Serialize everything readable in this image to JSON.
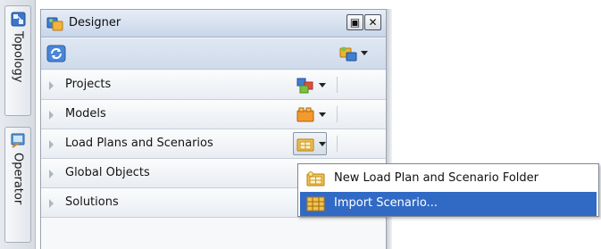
{
  "side_tabs": [
    {
      "label": "Topology",
      "icon": "topology-icon"
    },
    {
      "label": "Operator",
      "icon": "operator-icon"
    }
  ],
  "designer": {
    "title": "Designer",
    "window_buttons": {
      "restore": "▣",
      "close": "✕"
    },
    "toolbar": {
      "refresh_icon": "refresh-icon",
      "new_icon": "new-folder-icon"
    },
    "accordion": [
      {
        "label": "Projects",
        "icon": "projects-icon"
      },
      {
        "label": "Models",
        "icon": "models-icon"
      },
      {
        "label": "Load Plans and Scenarios",
        "icon": "load-plan-folder-icon"
      },
      {
        "label": "Global Objects"
      },
      {
        "label": "Solutions"
      }
    ]
  },
  "context_menu": {
    "items": [
      {
        "label": "New Load Plan and Scenario Folder",
        "icon": "new-load-plan-folder-icon",
        "highlighted": false
      },
      {
        "label": "Import Scenario...",
        "icon": "import-scenario-icon",
        "highlighted": true
      }
    ]
  },
  "colors": {
    "highlight": "#316ac5",
    "titlebar": "#c9d6e9",
    "panel_bg": "#f4f6f9"
  }
}
